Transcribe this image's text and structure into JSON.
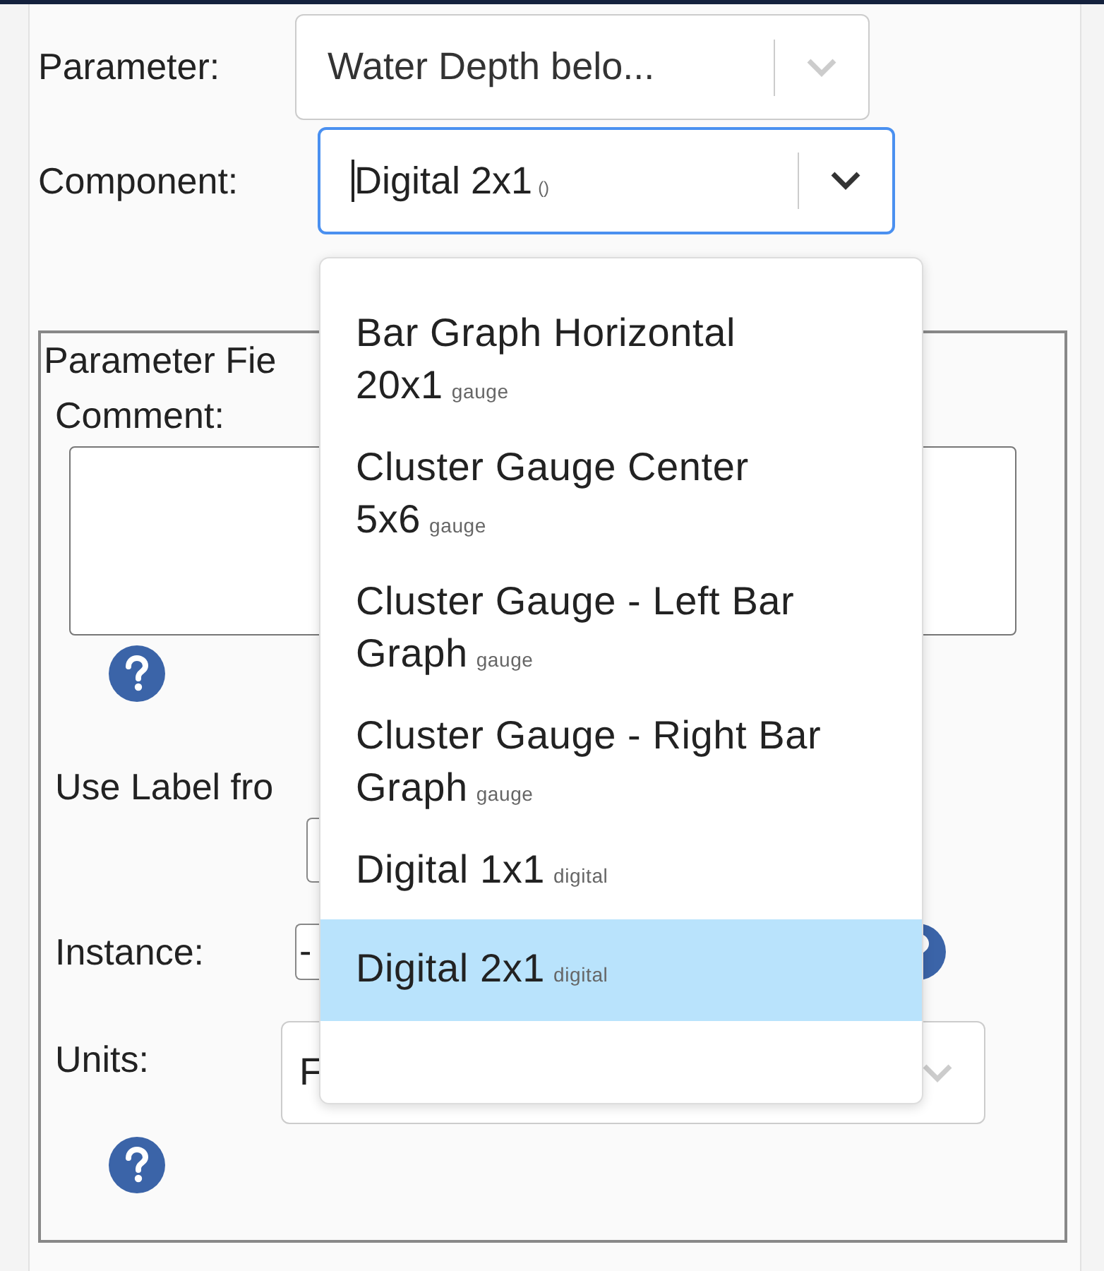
{
  "parameter": {
    "label": "Parameter:",
    "value": "Water Depth belo...",
    "disabled": true
  },
  "component": {
    "label": "Component:",
    "value": "Digital 2x1",
    "tag": "()",
    "focused": true
  },
  "fieldset": {
    "legend": "Parameter Fie",
    "comment_label": "Comment:",
    "use_label": "Use Label fro",
    "instance_label": "Instance:",
    "instance_value": "-",
    "units_label": "Units:",
    "units_value": "F"
  },
  "menu": [
    {
      "name": "Bar Graph Horizontal 20x1",
      "tag": "gauge",
      "selected": false
    },
    {
      "name": "Cluster Gauge Center 5x6",
      "tag": "gauge",
      "selected": false
    },
    {
      "name": "Cluster Gauge - Left Bar Graph",
      "tag": "gauge",
      "selected": false
    },
    {
      "name": "Cluster Gauge - Right Bar Graph",
      "tag": "gauge",
      "selected": false
    },
    {
      "name": "Digital 1x1",
      "tag": "digital",
      "selected": false
    },
    {
      "name": "Digital 2x1",
      "tag": "digital",
      "selected": true
    }
  ]
}
